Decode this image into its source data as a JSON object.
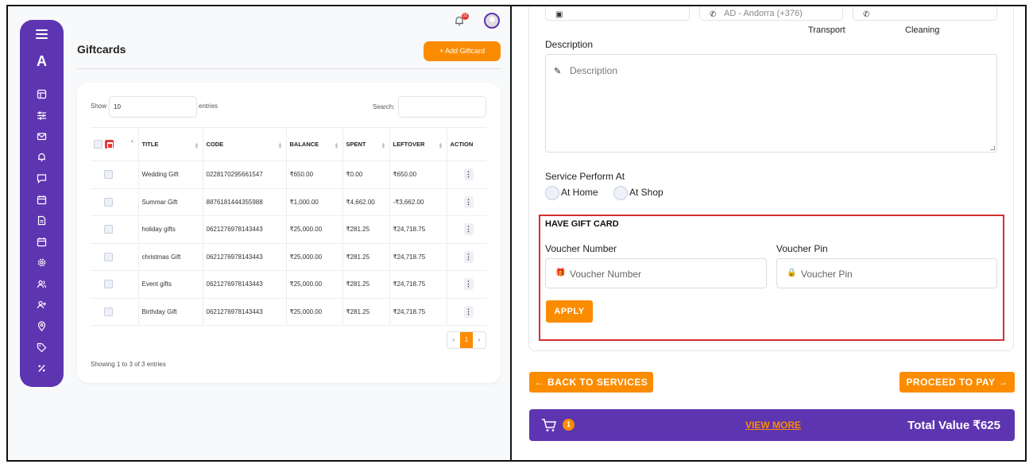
{
  "giftcards_panel": {
    "notification_count": "22",
    "logo_letter": "A",
    "page_title": "Giftcards",
    "add_button": "+ Add Giftcard",
    "show_label": "Show",
    "show_value": "10",
    "entries_label": "entries",
    "search_label": "Search:",
    "columns": [
      "TITLE",
      "CODE",
      "BALANCE",
      "SPENT",
      "LEFTOVER",
      "ACTION"
    ],
    "rows": [
      {
        "title": "Wedding Gift",
        "code": "0228170295661547",
        "balance": "₹650.00",
        "spent": "₹0.00",
        "leftover": "₹650.00"
      },
      {
        "title": "Summar Gift",
        "code": "8876181444355988",
        "balance": "₹1,000.00",
        "spent": "₹4,662.00",
        "leftover": "-₹3,662.00"
      },
      {
        "title": "holiday gifts",
        "code": "0621276978143443",
        "balance": "₹25,000.00",
        "spent": "₹281.25",
        "leftover": "₹24,718.75"
      },
      {
        "title": "christmas Gift",
        "code": "0621276978143443",
        "balance": "₹25,000.00",
        "spent": "₹281.25",
        "leftover": "₹24,718.75"
      },
      {
        "title": "Event gifts",
        "code": "0621276978143443",
        "balance": "₹25,000.00",
        "spent": "₹281.25",
        "leftover": "₹24,718.75"
      },
      {
        "title": "Birthday Gift",
        "code": "0621276978143443",
        "balance": "₹25,000.00",
        "spent": "₹281.25",
        "leftover": "₹24,718.75"
      }
    ],
    "pager": {
      "prev": "‹",
      "page": "1",
      "next": "›"
    },
    "showing_text": "Showing 1 to 3 of 3 entries",
    "sidebar_icons": [
      "layout-icon",
      "sliders-icon",
      "mail-icon",
      "bell-icon",
      "chat-icon",
      "calendar-icon",
      "document-icon",
      "calendar-alt-icon",
      "gear-icon",
      "users-icon",
      "user-plus-icon",
      "location-icon",
      "tag-icon",
      "percent-icon"
    ]
  },
  "booking_panel": {
    "top_inputs": {
      "phone_code": "AD - Andorra (+376)"
    },
    "top_labels": {
      "transport": "Transport",
      "cleaning": "Cleaning"
    },
    "description_label": "Description",
    "description_placeholder": "Description",
    "service_label": "Service Perform At",
    "options": [
      "At Home",
      "At Shop"
    ],
    "gift_title": "HAVE GIFT CARD",
    "voucher_number_label": "Voucher Number",
    "voucher_number_placeholder": "Voucher Number",
    "voucher_pin_label": "Voucher Pin",
    "voucher_pin_placeholder": "Voucher Pin",
    "apply_button": "APPLY",
    "back_button": "← BACK TO SERVICES",
    "proceed_button": "PROCEED TO PAY →",
    "cart_count": "1",
    "view_more": "VIEW MORE",
    "total": "Total Value ₹625"
  },
  "colors": {
    "primary": "#5e35b1",
    "accent": "#fb8c00",
    "highlight_border": "#d32f2f"
  }
}
